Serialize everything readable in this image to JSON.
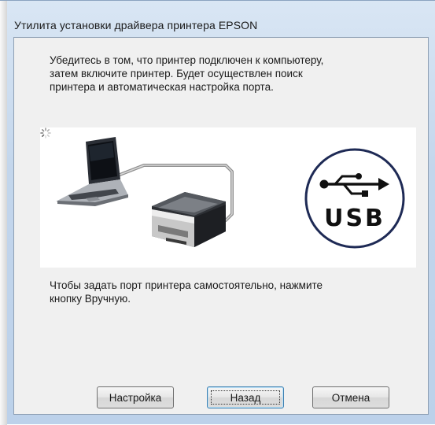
{
  "window": {
    "title": "Утилита установки драйвера принтера EPSON"
  },
  "content": {
    "instructions": "Убедитесь в том, что принтер подключен к компьютеру,\nзатем включите принтер. Будет осуществлен поиск\nпринтера и автоматическая настройка порта.",
    "illustration": {
      "usb_label": "USB",
      "icons": [
        "laptop-icon",
        "printer-icon",
        "usb-icon",
        "loading-spinner-icon"
      ]
    },
    "manual_hint": "Чтобы задать порт принтера самостоятельно, нажмите\nкнопку Вручную."
  },
  "buttons": {
    "settings": "Настройка",
    "back": "Назад",
    "cancel": "Отмена"
  },
  "colors": {
    "usb_circle": "#1e2a55",
    "window_frame": "#c3d6ec",
    "dialog_bg": "#f0f0f0"
  }
}
